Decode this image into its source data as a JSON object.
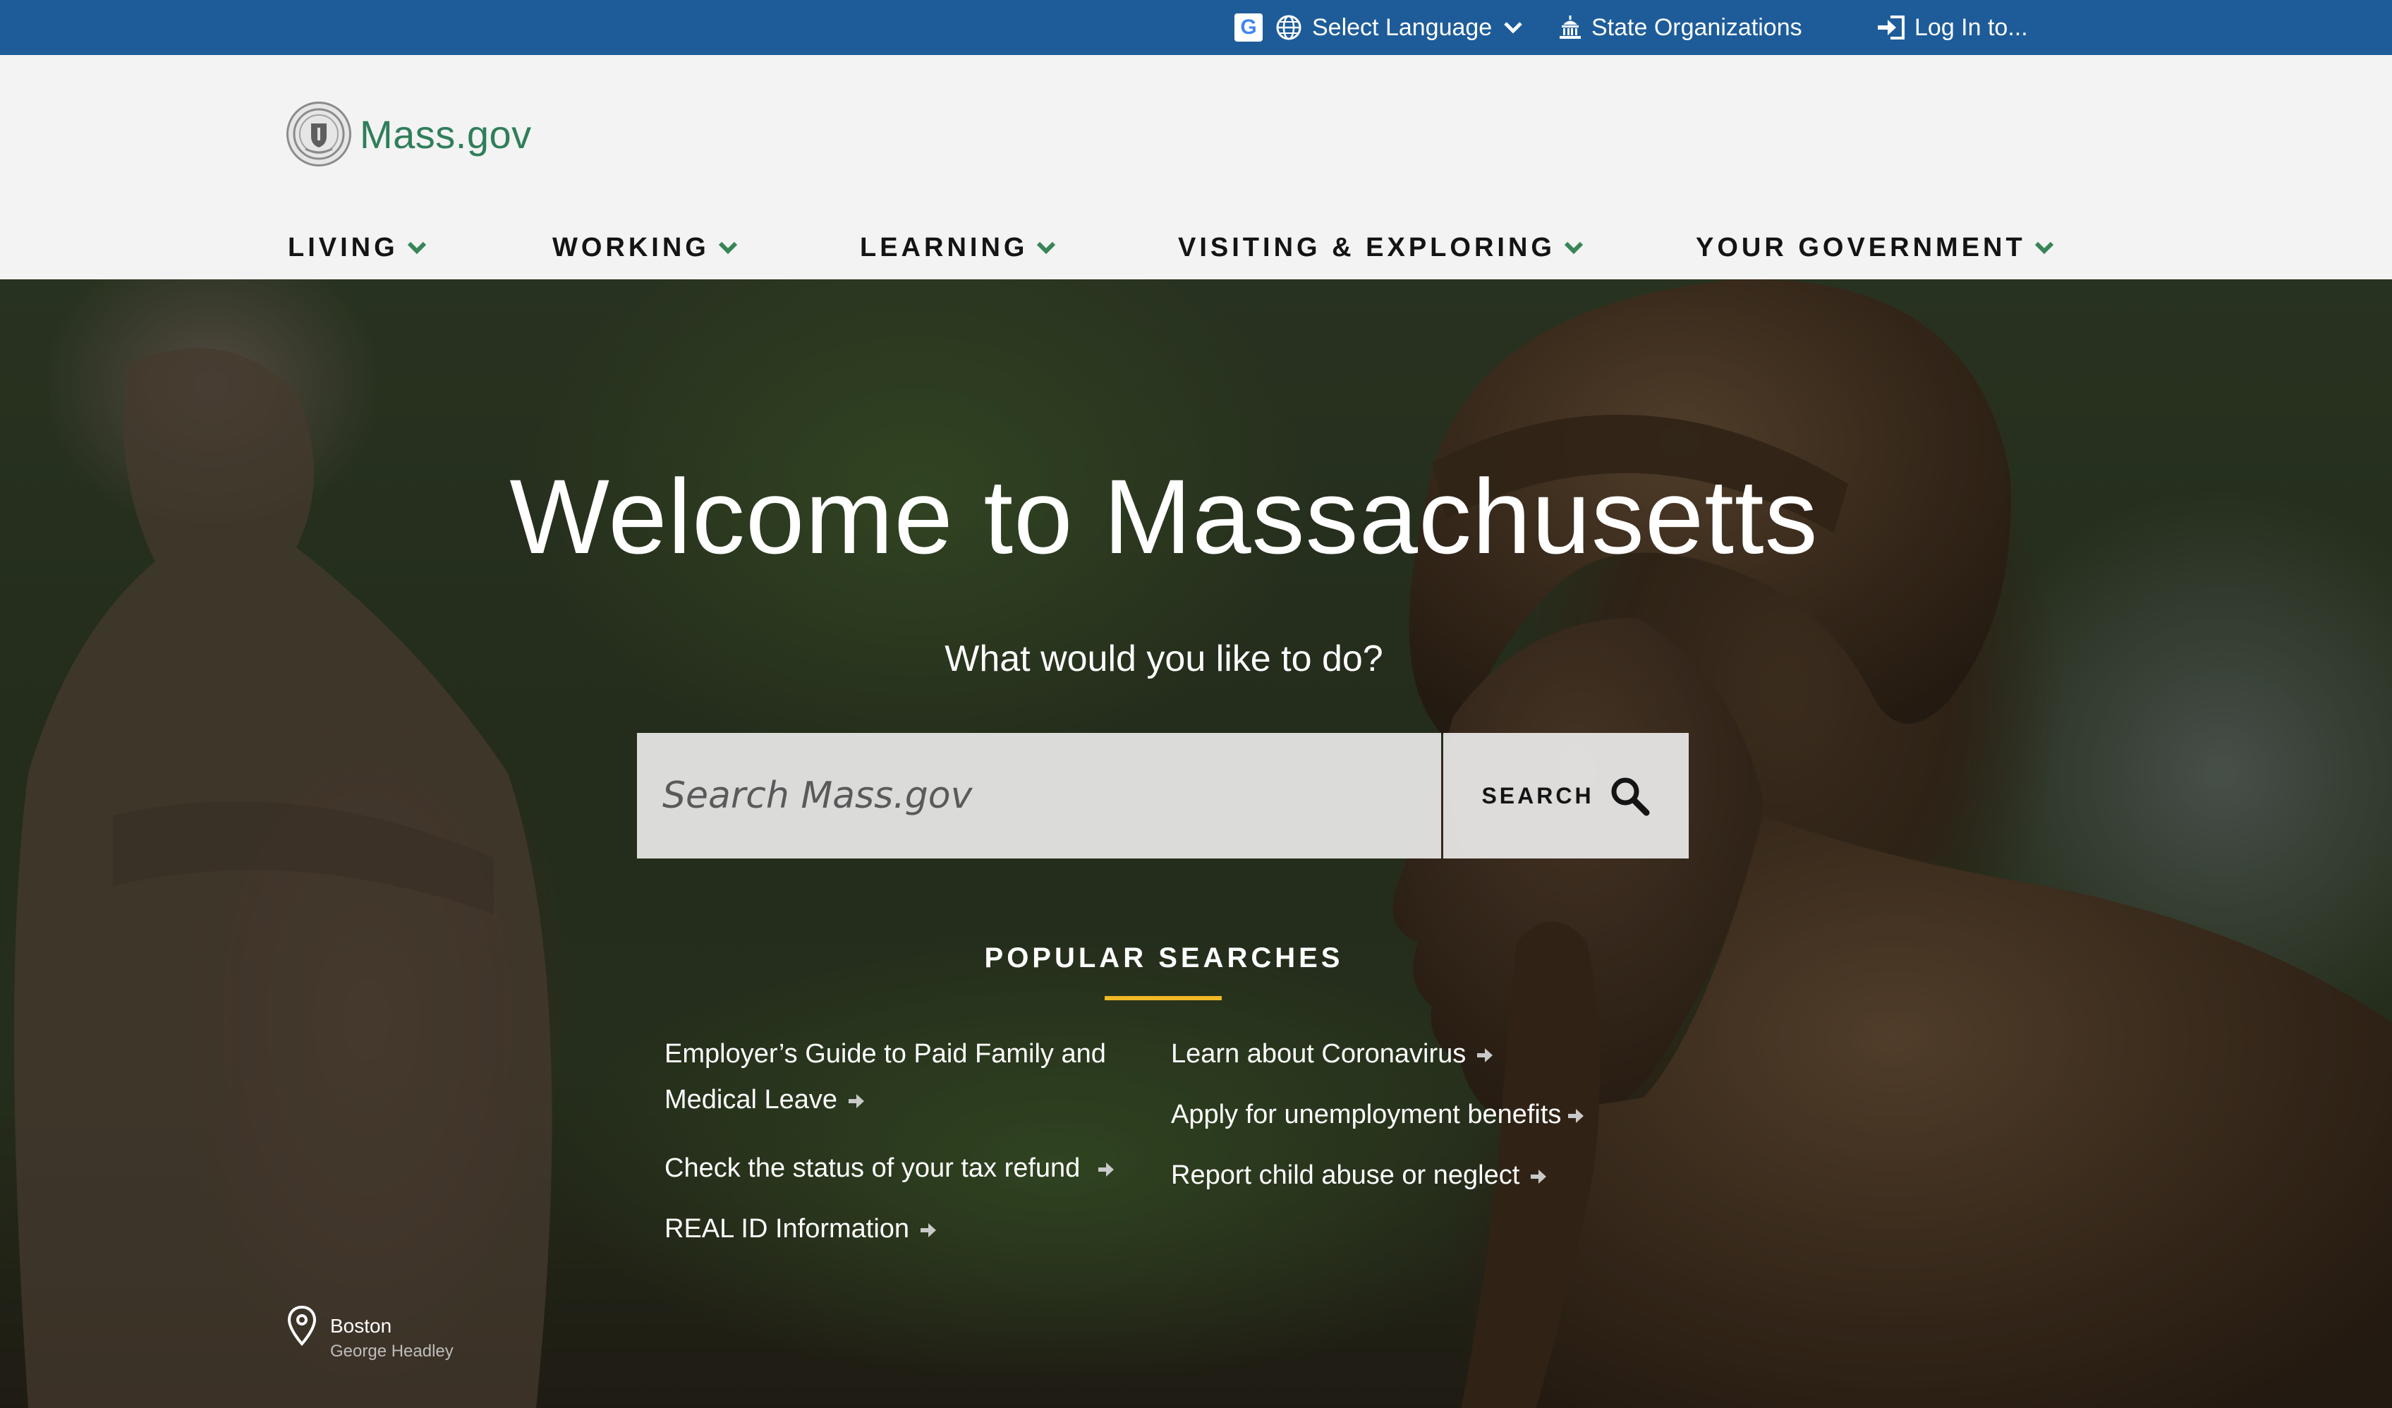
{
  "utility": {
    "language_label": "Select Language",
    "organizations_label": "State Organizations",
    "login_label": "Log In to..."
  },
  "header": {
    "brand_name": "Mass.gov",
    "nav": [
      {
        "label": "LIVING"
      },
      {
        "label": "WORKING"
      },
      {
        "label": "LEARNING"
      },
      {
        "label": "VISITING & EXPLORING"
      },
      {
        "label": "YOUR GOVERNMENT"
      }
    ]
  },
  "hero": {
    "title": "Welcome to Massachusetts",
    "subtitle": "What would you like to do?",
    "search": {
      "placeholder": "Search Mass.gov",
      "button_label": "SEARCH"
    },
    "popular_heading": "POPULAR SEARCHES",
    "popular_links": [
      {
        "label": "Employer’s Guide to Paid Family and Medical Leave"
      },
      {
        "label": "Check the status of your tax refund"
      },
      {
        "label": "REAL ID Information"
      },
      {
        "label": "Learn about Coronavirus"
      },
      {
        "label": "Apply for unemployment benefits"
      },
      {
        "label": "Report child abuse or neglect"
      }
    ],
    "photo_credit": {
      "place": "Boston",
      "artist": "George Headley"
    }
  },
  "colors": {
    "utility_bar": "#1e5c99",
    "brand_green": "#2f7e5a",
    "nav_chevron": "#388557",
    "popular_underline": "#f1b826",
    "header_bg": "#f3f3f3"
  },
  "icons": {
    "google_translate": "google-translate-icon",
    "globe": "globe-icon",
    "capitol": "capitol-building-icon",
    "login": "login-arrow-icon",
    "search": "magnifier-icon",
    "link_arrow": "arrow-right-icon",
    "location": "map-pin-icon",
    "nav_chevron": "chevron-down-icon"
  }
}
